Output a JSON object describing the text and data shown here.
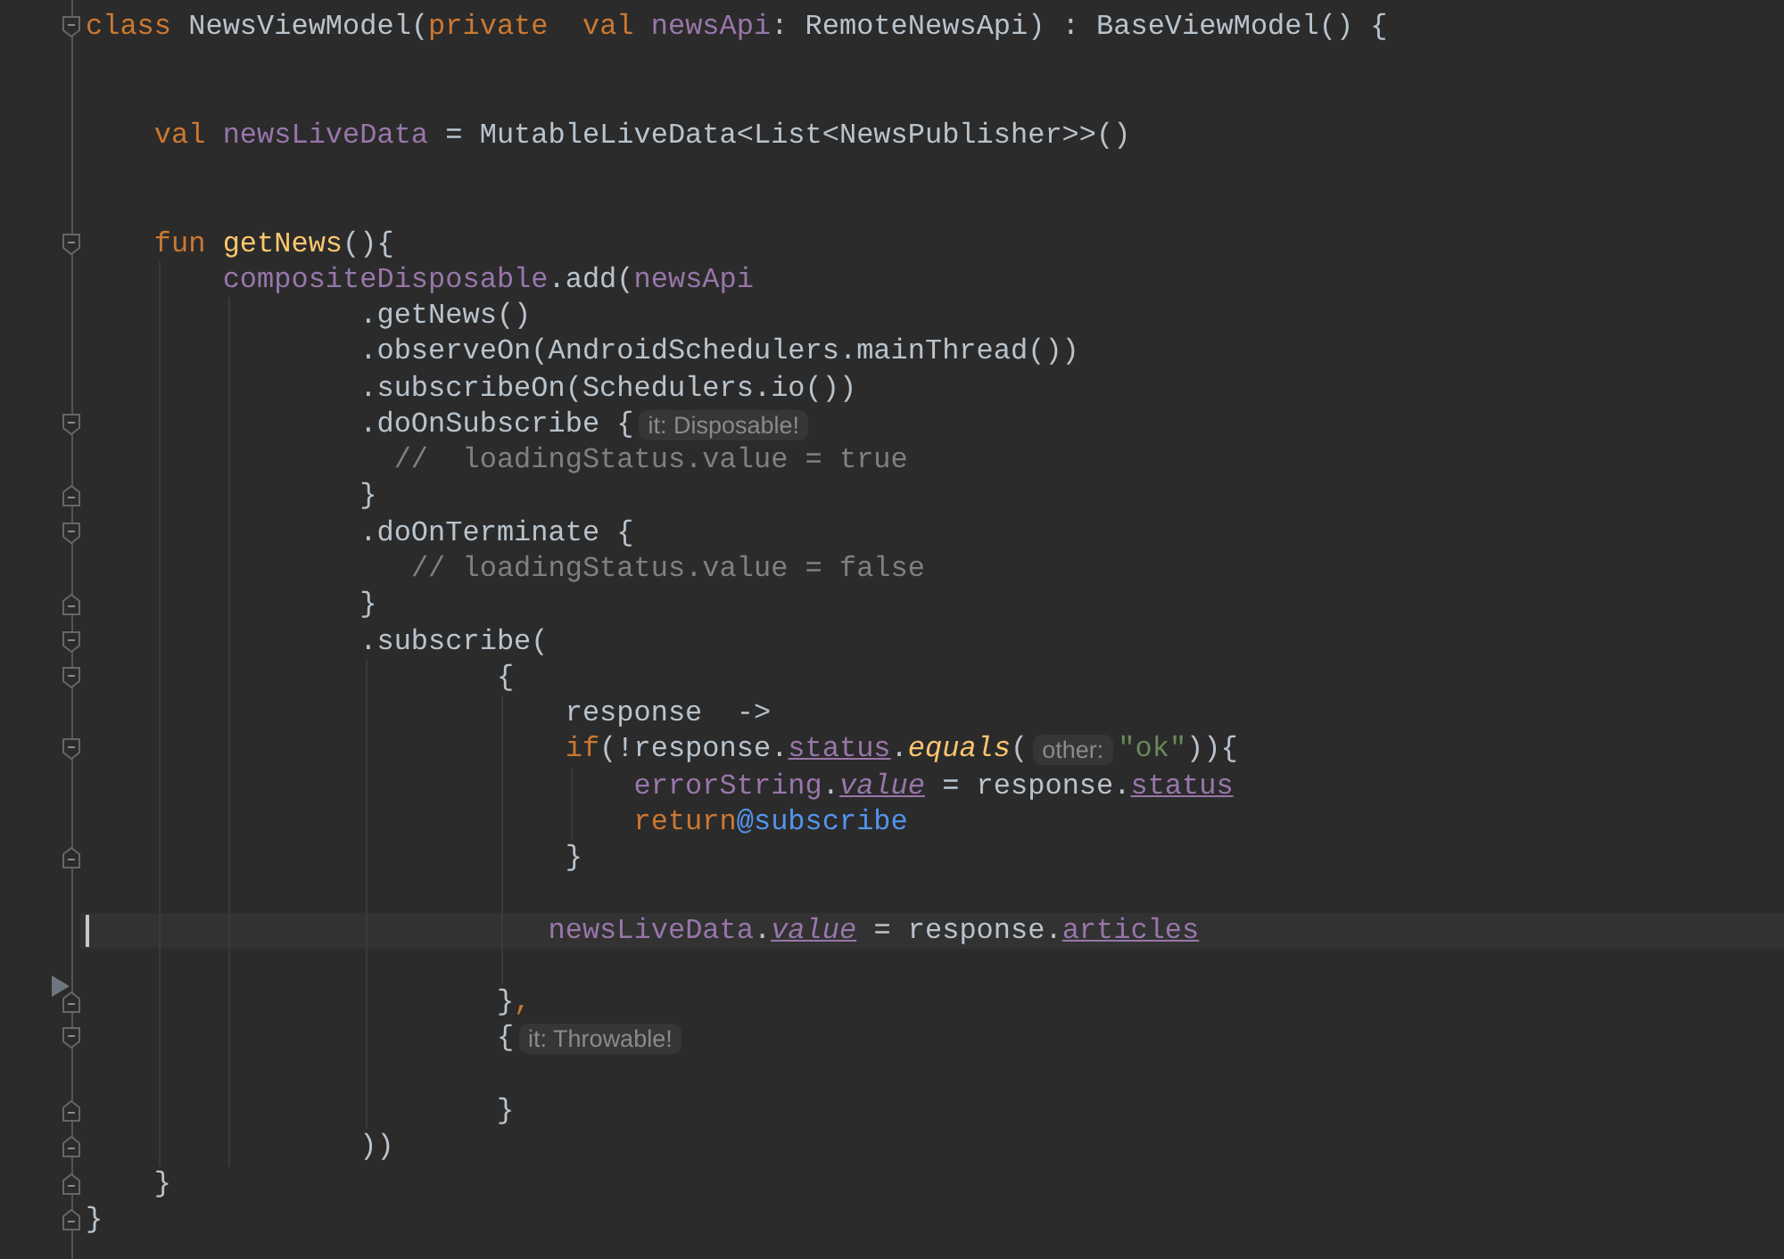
{
  "lines": [
    {
      "kind": "code",
      "fold_open": true,
      "segments": [
        {
          "kind": "code",
          "tokens": [
            {
              "kind": "keyword",
              "text": "class"
            },
            {
              "kind": "plain",
              "text": " NewsViewModel("
            },
            {
              "kind": "keyword",
              "text": "private  "
            },
            {
              "kind": "keyword",
              "text": "val "
            },
            {
              "kind": "property",
              "text": "newsApi"
            },
            {
              "kind": "plain",
              "text": ": RemoteNewsApi) : BaseViewModel() {"
            }
          ]
        }
      ]
    },
    {
      "kind": "blank"
    },
    {
      "kind": "blank"
    },
    {
      "kind": "code",
      "segments": [
        {
          "kind": "code",
          "tokens": [
            {
              "kind": "keyword",
              "text": "    val "
            },
            {
              "kind": "property",
              "text": "newsLiveData"
            },
            {
              "kind": "plain",
              "text": " = MutableLiveData<List<NewsPublisher>>()"
            }
          ]
        }
      ]
    },
    {
      "kind": "blank"
    },
    {
      "kind": "blank"
    },
    {
      "kind": "code",
      "fold_open": true,
      "segments": [
        {
          "kind": "code",
          "tokens": [
            {
              "kind": "keyword",
              "text": "    fun "
            },
            {
              "kind": "function",
              "text": "getNews"
            },
            {
              "kind": "plain",
              "text": "(){"
            }
          ]
        }
      ]
    },
    {
      "kind": "code",
      "segments": [
        {
          "kind": "code",
          "tokens": [
            {
              "kind": "property",
              "text": "        compositeDisposable"
            },
            {
              "kind": "plain",
              "text": ".add("
            },
            {
              "kind": "property",
              "text": "newsApi"
            }
          ]
        }
      ]
    },
    {
      "kind": "code",
      "segments": [
        {
          "kind": "code",
          "tokens": [
            {
              "kind": "plain",
              "text": "                .getNews()"
            }
          ]
        }
      ]
    },
    {
      "kind": "code",
      "segments": [
        {
          "kind": "code",
          "tokens": [
            {
              "kind": "plain",
              "text": "                .observeOn(AndroidSchedulers.mainThread())"
            }
          ]
        }
      ]
    },
    {
      "kind": "code",
      "segments": [
        {
          "kind": "code",
          "tokens": [
            {
              "kind": "plain",
              "text": "                .subscribeOn(Schedulers.io())"
            }
          ]
        }
      ]
    },
    {
      "kind": "code",
      "fold_open": true,
      "segments": [
        {
          "kind": "code",
          "tokens": [
            {
              "kind": "plain",
              "text": "                .doOnSubscribe {"
            }
          ]
        },
        {
          "kind": "hint",
          "text": "it: Disposable!"
        }
      ]
    },
    {
      "kind": "code",
      "segments": [
        {
          "kind": "code",
          "tokens": [
            {
              "kind": "comment",
              "text": "                  //  loadingStatus.value = true"
            }
          ]
        }
      ]
    },
    {
      "kind": "code",
      "fold_close": true,
      "segments": [
        {
          "kind": "code",
          "tokens": [
            {
              "kind": "plain",
              "text": "                }"
            }
          ]
        }
      ]
    },
    {
      "kind": "code",
      "fold_open": true,
      "segments": [
        {
          "kind": "code",
          "tokens": [
            {
              "kind": "plain",
              "text": "                .doOnTerminate {"
            }
          ]
        }
      ]
    },
    {
      "kind": "code",
      "segments": [
        {
          "kind": "code",
          "tokens": [
            {
              "kind": "comment",
              "text": "                   // loadingStatus.value = false"
            }
          ]
        }
      ]
    },
    {
      "kind": "code",
      "fold_close": true,
      "segments": [
        {
          "kind": "code",
          "tokens": [
            {
              "kind": "plain",
              "text": "                }"
            }
          ]
        }
      ]
    },
    {
      "kind": "code",
      "fold_open": true,
      "segments": [
        {
          "kind": "code",
          "tokens": [
            {
              "kind": "plain",
              "text": "                .subscribe("
            }
          ]
        }
      ]
    },
    {
      "kind": "code",
      "fold_open": true,
      "segments": [
        {
          "kind": "code",
          "tokens": [
            {
              "kind": "plain",
              "text": "                        {"
            }
          ]
        }
      ]
    },
    {
      "kind": "code",
      "segments": [
        {
          "kind": "code",
          "tokens": [
            {
              "kind": "plain",
              "text": "                            response  ->"
            }
          ]
        }
      ]
    },
    {
      "kind": "code",
      "fold_open": true,
      "segments": [
        {
          "kind": "code",
          "tokens": [
            {
              "kind": "keyword",
              "text": "                            if"
            },
            {
              "kind": "plain",
              "text": "(!response."
            },
            {
              "kind": "synthetic",
              "text": "status"
            },
            {
              "kind": "plain",
              "text": "."
            },
            {
              "kind": "extension",
              "text": "equals"
            },
            {
              "kind": "plain",
              "text": "("
            }
          ]
        },
        {
          "kind": "hint",
          "text": "other:"
        },
        {
          "kind": "code",
          "tokens": [
            {
              "kind": "string",
              "text": "\"ok\""
            },
            {
              "kind": "plain",
              "text": ")){"
            }
          ]
        }
      ]
    },
    {
      "kind": "code",
      "segments": [
        {
          "kind": "code",
          "tokens": [
            {
              "kind": "property",
              "text": "                                errorString"
            },
            {
              "kind": "plain",
              "text": "."
            },
            {
              "kind": "synthetic-italic",
              "text": "value"
            },
            {
              "kind": "plain",
              "text": " = response."
            },
            {
              "kind": "synthetic",
              "text": "status"
            }
          ]
        }
      ]
    },
    {
      "kind": "code",
      "segments": [
        {
          "kind": "code",
          "tokens": [
            {
              "kind": "keyword",
              "text": "                                return"
            },
            {
              "kind": "label",
              "text": "@subscribe"
            }
          ]
        }
      ]
    },
    {
      "kind": "code",
      "fold_close": true,
      "segments": [
        {
          "kind": "code",
          "tokens": [
            {
              "kind": "plain",
              "text": "                            }"
            }
          ]
        }
      ]
    },
    {
      "kind": "blank"
    },
    {
      "kind": "code",
      "current": true,
      "segments": [
        {
          "kind": "code",
          "tokens": [
            {
              "kind": "property",
              "text": "                           newsLiveData"
            },
            {
              "kind": "plain",
              "text": "."
            },
            {
              "kind": "synthetic-italic",
              "text": "value"
            },
            {
              "kind": "plain",
              "text": " = response."
            },
            {
              "kind": "synthetic",
              "text": "articles"
            }
          ]
        }
      ]
    },
    {
      "kind": "blank",
      "arrow": true
    },
    {
      "kind": "code",
      "fold_close": true,
      "segments": [
        {
          "kind": "code",
          "tokens": [
            {
              "kind": "plain",
              "text": "                        }"
            },
            {
              "kind": "keyword",
              "text": ","
            }
          ]
        }
      ]
    },
    {
      "kind": "code",
      "fold_open": true,
      "segments": [
        {
          "kind": "code",
          "tokens": [
            {
              "kind": "plain",
              "text": "                        {"
            }
          ]
        },
        {
          "kind": "hint",
          "text": "it: Throwable!"
        }
      ]
    },
    {
      "kind": "blank"
    },
    {
      "kind": "code",
      "fold_close": true,
      "segments": [
        {
          "kind": "code",
          "tokens": [
            {
              "kind": "plain",
              "text": "                        }"
            }
          ]
        }
      ]
    },
    {
      "kind": "code",
      "fold_close": true,
      "segments": [
        {
          "kind": "code",
          "tokens": [
            {
              "kind": "plain",
              "text": "                ))"
            }
          ]
        }
      ]
    },
    {
      "kind": "code",
      "fold_close": true,
      "segments": [
        {
          "kind": "code",
          "tokens": [
            {
              "kind": "plain",
              "text": "    }"
            }
          ]
        }
      ]
    },
    {
      "kind": "code",
      "fold_close": true,
      "segments": [
        {
          "kind": "code",
          "tokens": [
            {
              "kind": "plain",
              "text": "}"
            }
          ]
        }
      ]
    }
  ]
}
